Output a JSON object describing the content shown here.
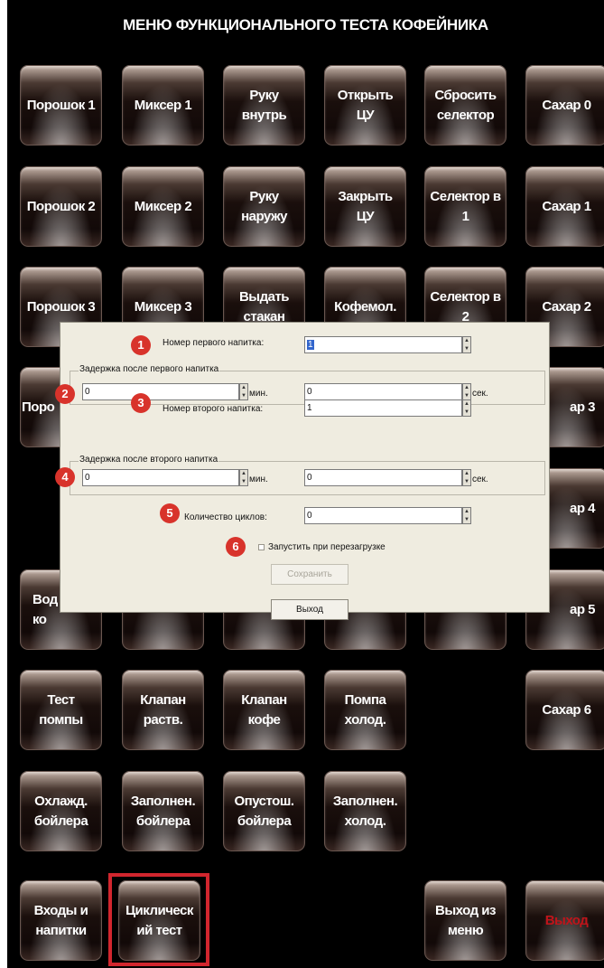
{
  "window": {
    "title": "МЕНЮ ФУНКЦИОНАЛЬНОГО ТЕСТА КОФЕЙНИКА"
  },
  "tiles": {
    "powder1": "Порошок 1",
    "mixer1": "Миксер 1",
    "arm_in": "Руку\nвнутрь",
    "open_cu": "Открыть\nЦУ",
    "reset_selector": "Сбросить\nселектор",
    "sugar0": "Сахар 0",
    "powder2": "Порошок 2",
    "mixer2": "Миксер 2",
    "arm_out": "Руку\nнаружу",
    "close_cu": "Закрыть\nЦУ",
    "selector1": "Селектор в\n1",
    "sugar1": "Сахар 1",
    "powder3": "Порошок 3",
    "mixer3": "Миксер 3",
    "dispense_cup": "Выдать\nстакан",
    "grinder": "Кофемол.",
    "selector2": "Селектор в\n2",
    "sugar2": "Сахар 2",
    "powder4_partial": "Поро",
    "sugar3_partial": "ар 3",
    "sugar4_partial": "ар 4",
    "water_coffee_partial": "Вод\nко",
    "sugar5_partial": "ар 5",
    "pump_test": "Тест\nпомпы",
    "valve_solution": "Клапан\nраств.",
    "valve_coffee": "Клапан\nкофе",
    "pump_cold": "Помпа\nхолод.",
    "sugar6": "Сахар 6",
    "boiler_cool": "Охлажд.\nбойлера",
    "boiler_fill": "Заполнен.\nбойлера",
    "boiler_empty": "Опустош.\nбойлера",
    "cold_fill": "Заполнен.\nхолод.",
    "inputs_drinks": "Входы и\nнапитки",
    "cyclic_test": "Циклическ\nий тест",
    "exit_menu": "Выход из\nменю",
    "exit": "Выход"
  },
  "dialog": {
    "first_drink_label": "Номер первого напитка:",
    "first_drink_value": "1",
    "delay1_group": "Задержка после первого напитка",
    "delay1_min_value": "0",
    "delay1_min_unit": "мин.",
    "delay1_sec_value": "0",
    "delay1_sec_unit": "сек.",
    "second_drink_label": "Номер второго напитка:",
    "second_drink_value": "1",
    "delay2_group": "Задержка после второго напитка",
    "delay2_min_value": "0",
    "delay2_min_unit": "мин.",
    "delay2_sec_value": "0",
    "delay2_sec_unit": "сек.",
    "cycles_label": "Количество циклов:",
    "cycles_value": "0",
    "autostart_label": "Запустить при перезагрузке",
    "save_button": "Сохранить",
    "exit_button": "Выход"
  },
  "badges": [
    "1",
    "2",
    "3",
    "4",
    "5",
    "6"
  ],
  "colors": {
    "highlight": "#d1262e",
    "badge": "#d8332b",
    "exit_text": "#c0141a"
  }
}
